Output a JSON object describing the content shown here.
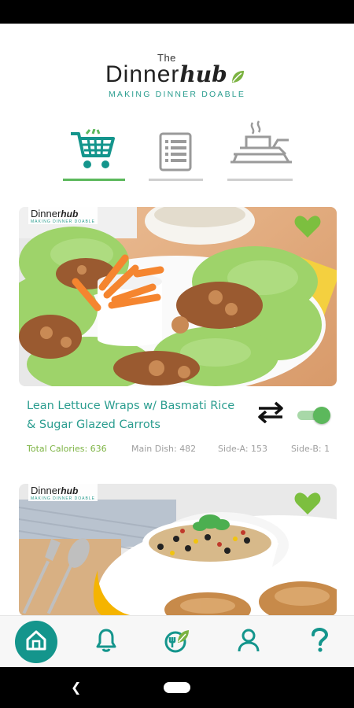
{
  "brand": {
    "the": "The",
    "dinner": "Dinner",
    "hub": "hub",
    "tagline": "MAKING DINNER DOABLE"
  },
  "tabs": [
    {
      "icon": "shopping-cart-icon",
      "active": true
    },
    {
      "icon": "checklist-icon",
      "active": false
    },
    {
      "icon": "cooking-pot-icon",
      "active": false
    }
  ],
  "meals": [
    {
      "title_line1": "Lean Lettuce Wraps w/ Basmati Rice",
      "title_line2": "& Sugar Glazed Carrots",
      "favorited": true,
      "toggle_on": true,
      "stats": {
        "calories": "Total Calories: 636",
        "main": "Main Dish: 482",
        "side_a": "Side-A: 153",
        "side_b": "Side-B: 1"
      },
      "watermark": {
        "a": "Dinner",
        "b": "hub",
        "c": "MAKING DINNER DOABLE"
      }
    },
    {
      "favorited": true,
      "watermark": {
        "a": "Dinner",
        "b": "hub",
        "c": "MAKING DINNER DOABLE"
      }
    }
  ],
  "bottom_nav": [
    {
      "icon": "home-icon",
      "active": true
    },
    {
      "icon": "bell-icon",
      "active": false
    },
    {
      "icon": "food-leaf-icon",
      "active": false
    },
    {
      "icon": "user-icon",
      "active": false
    },
    {
      "icon": "help-icon",
      "active": false
    }
  ],
  "colors": {
    "teal": "#2a9d8f",
    "green": "#5cb85c",
    "nav_teal": "#14958c",
    "calories_green": "#7cb342"
  }
}
